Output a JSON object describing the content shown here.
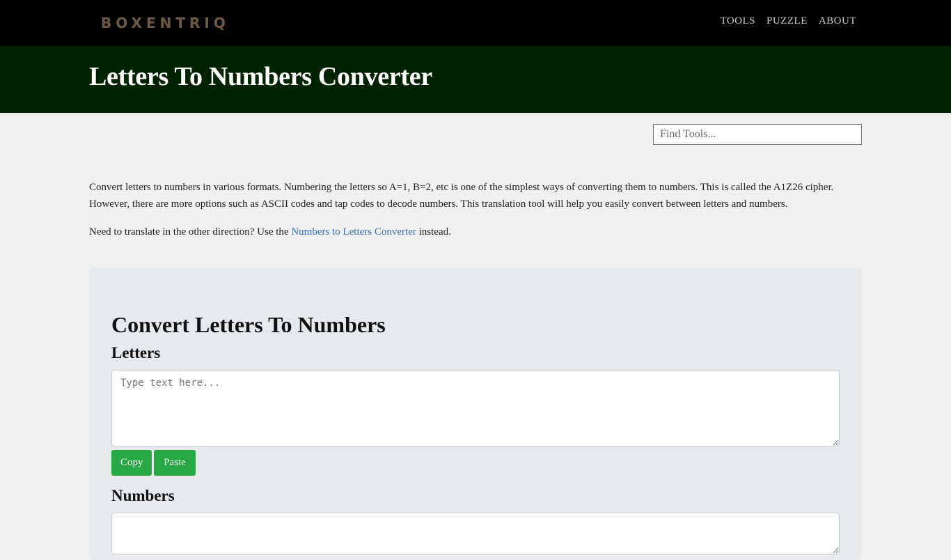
{
  "nav": {
    "logo": "BOXENTRIQ",
    "links": [
      "TOOLS",
      "PUZZLE",
      "ABOUT"
    ]
  },
  "banner": {
    "title": "Letters To Numbers Converter"
  },
  "search": {
    "placeholder": "Find Tools..."
  },
  "intro": {
    "paragraph1": "Convert letters to numbers in various formats. Numbering the letters so A=1, B=2, etc is one of the simplest ways of converting them to numbers. This is called the A1Z26 cipher. However, there are more options such as ASCII codes and tap codes to decode numbers. This translation tool will help you easily convert between letters and numbers.",
    "paragraph2_before": "Need to translate in the other direction? Use the ",
    "paragraph2_link": "Numbers to Letters Converter",
    "paragraph2_after": " instead."
  },
  "tool": {
    "heading": "Convert Letters To Numbers",
    "letters_label": "Letters",
    "letters_placeholder": "Type text here...",
    "letters_value": "",
    "copy_label": "Copy",
    "paste_label": "Paste",
    "numbers_label": "Numbers",
    "numbers_value": ""
  },
  "colors": {
    "nav_bg": "#000000",
    "banner_bg": "#002200",
    "accent_button": "#28a745",
    "link": "#3a6fc4"
  }
}
